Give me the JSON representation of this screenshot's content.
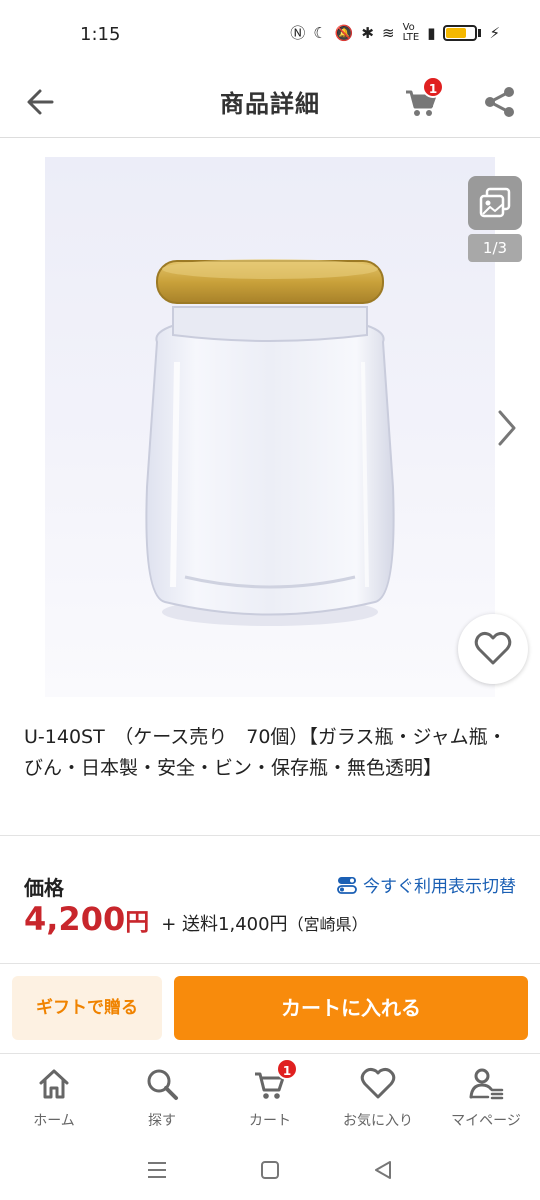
{
  "status_bar": {
    "time": "1:15",
    "icons": [
      "nfc-icon",
      "moon-icon",
      "vibrate-off-icon",
      "bluetooth-icon",
      "wifi-icon",
      "volte-icon",
      "signal-icon",
      "battery-icon",
      "charging-icon"
    ],
    "battery_level": 0.7
  },
  "header": {
    "title": "商品詳細",
    "cart_badge": "1"
  },
  "gallery": {
    "page_indicator": "1/3",
    "accent": "#c9a13a"
  },
  "product": {
    "title": "U-140ST　（ケース売り　70個）【ガラス瓶・ジャム瓶・びん・日本製・安全・ビン・保存瓶・無色透明】"
  },
  "price": {
    "label": "価格",
    "display_toggle": "今すぐ利用表示切替",
    "value": "4,200",
    "currency": "円",
    "shipping": "+ 送料1,400円",
    "shipping_region": "（宮崎県）",
    "color": "#c8262c"
  },
  "actions": {
    "gift": "ギフトで贈る",
    "add_to_cart": "カートに入れる",
    "accent": "#f88b0c"
  },
  "bottom_nav": {
    "items": [
      {
        "label": "ホーム",
        "icon": "home-icon"
      },
      {
        "label": "探す",
        "icon": "search-icon"
      },
      {
        "label": "カート",
        "icon": "cart-icon",
        "badge": "1"
      },
      {
        "label": "お気に入り",
        "icon": "heart-icon"
      },
      {
        "label": "マイページ",
        "icon": "user-icon"
      }
    ]
  },
  "system_nav": [
    "menu-icon",
    "home-square-icon",
    "back-triangle-icon"
  ]
}
